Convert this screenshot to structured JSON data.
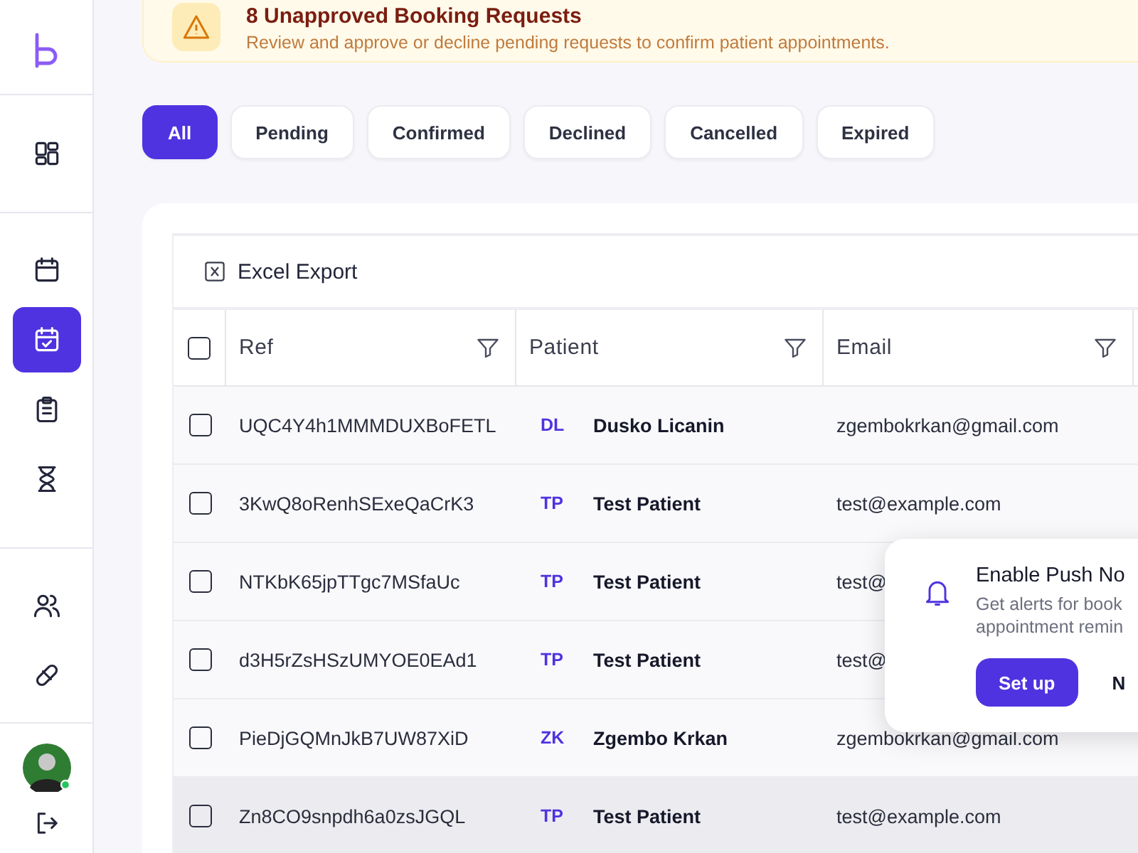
{
  "sidebar": {
    "items": [
      {
        "kind": "dashboard",
        "selected": false
      },
      {
        "kind": "calendar",
        "selected": false
      },
      {
        "kind": "calendar-check",
        "selected": true
      },
      {
        "kind": "clipboard",
        "selected": false
      },
      {
        "kind": "hourglass",
        "selected": false
      },
      {
        "kind": "users",
        "selected": false
      },
      {
        "kind": "pill",
        "selected": false
      }
    ],
    "user": {
      "online": true
    }
  },
  "banner": {
    "title": "8 Unapproved Booking Requests",
    "message": "Review and approve or decline pending requests to confirm patient appointments."
  },
  "filters": [
    {
      "label": "All",
      "selected": true
    },
    {
      "label": "Pending",
      "selected": false
    },
    {
      "label": "Confirmed",
      "selected": false
    },
    {
      "label": "Declined",
      "selected": false
    },
    {
      "label": "Cancelled",
      "selected": false
    },
    {
      "label": "Expired",
      "selected": false
    }
  ],
  "toolbar": {
    "export": "Excel Export"
  },
  "table": {
    "select_all": {
      "checked": false
    },
    "columns": [
      "Ref",
      "Patient",
      "Email"
    ],
    "rows": [
      {
        "checked": false,
        "hovered": false,
        "ref": "UQC4Y4h1MMMDUXBoFETL",
        "initials": "DL",
        "patient": "Dusko Licanin",
        "email": "zgembokrkan@gmail.com"
      },
      {
        "checked": false,
        "hovered": false,
        "ref": "3KwQ8oRenhSExeQaCrK3",
        "initials": "TP",
        "patient": "Test Patient",
        "email": "test@example.com"
      },
      {
        "checked": false,
        "hovered": false,
        "ref": "NTKbK65jpTTgc7MSfaUc",
        "initials": "TP",
        "patient": "Test Patient",
        "email": "test@"
      },
      {
        "checked": false,
        "hovered": false,
        "ref": "d3H5rZsHSzUMYOE0EAd1",
        "initials": "TP",
        "patient": "Test Patient",
        "email": "test@"
      },
      {
        "checked": false,
        "hovered": false,
        "ref": "PieDjGQMnJkB7UW87XiD",
        "initials": "ZK",
        "patient": "Zgembo Krkan",
        "email": "zgembokrkan@gmail.com"
      },
      {
        "checked": false,
        "hovered": true,
        "ref": "Zn8CO9snpdh6a0zsJGQL",
        "initials": "TP",
        "patient": "Test Patient",
        "email": "test@example.com"
      }
    ]
  },
  "toast": {
    "title": "Enable Push No",
    "message": "Get alerts for book appointment remin",
    "primary": "Set up",
    "secondary": "N"
  }
}
